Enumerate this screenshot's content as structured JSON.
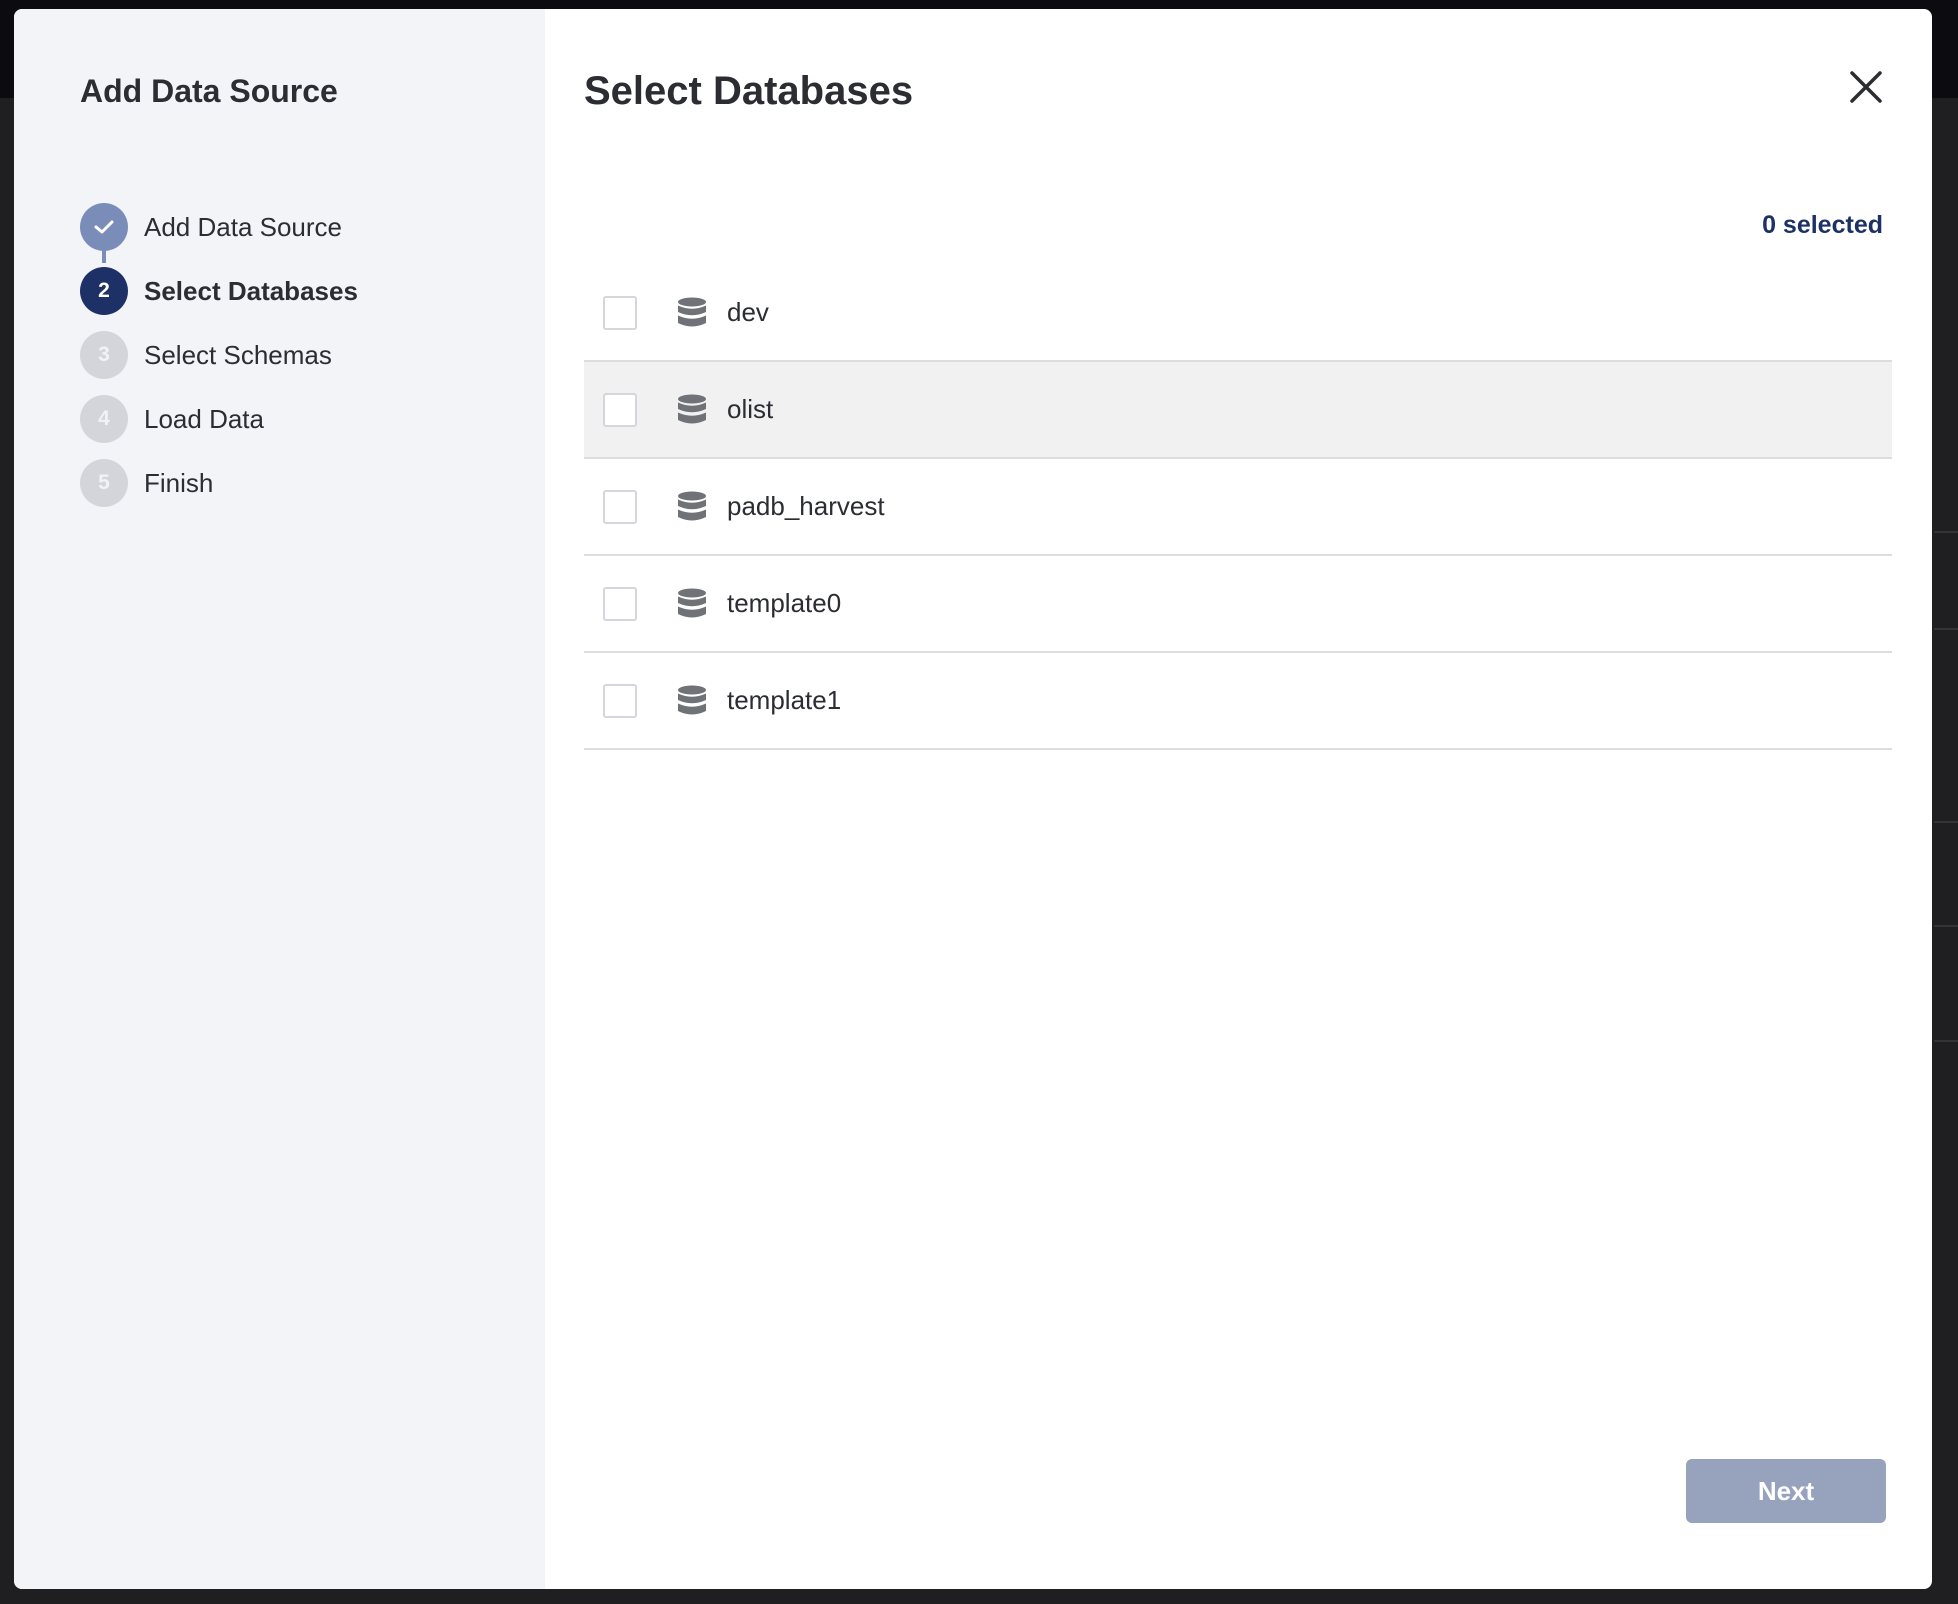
{
  "sidebar": {
    "title": "Add Data Source",
    "steps": [
      {
        "number": "",
        "label": "Add Data Source",
        "state": "done"
      },
      {
        "number": "2",
        "label": "Select Databases",
        "state": "active"
      },
      {
        "number": "3",
        "label": "Select Schemas",
        "state": "pending"
      },
      {
        "number": "4",
        "label": "Load Data",
        "state": "pending"
      },
      {
        "number": "5",
        "label": "Finish",
        "state": "pending"
      }
    ]
  },
  "main": {
    "title": "Select Databases",
    "selected_count": "0 selected",
    "databases": [
      {
        "name": "dev",
        "checked": false
      },
      {
        "name": "olist",
        "checked": false
      },
      {
        "name": "padb_harvest",
        "checked": false
      },
      {
        "name": "template0",
        "checked": false
      },
      {
        "name": "template1",
        "checked": false
      }
    ],
    "next_label": "Next"
  },
  "colors": {
    "accent": "#1d3166",
    "step_done": "#7a8db8",
    "step_pending": "#d3d5da",
    "next_disabled": "#97a3bd",
    "sidebar_bg": "#f3f4f8"
  },
  "icons": {
    "close": "close-icon",
    "check": "check-icon",
    "database": "database-icon"
  }
}
